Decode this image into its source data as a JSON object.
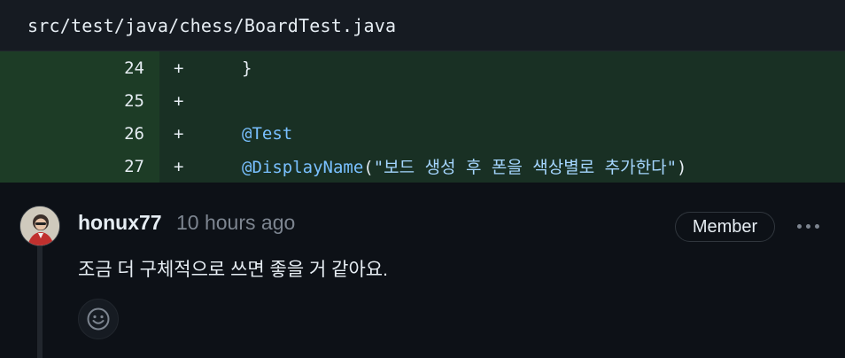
{
  "file": {
    "path": "src/test/java/chess/BoardTest.java"
  },
  "diff": {
    "lines": [
      {
        "number": "24",
        "marker": "+",
        "code": "}"
      },
      {
        "number": "25",
        "marker": "+",
        "code": ""
      },
      {
        "number": "26",
        "marker": "+",
        "code": "@Test"
      },
      {
        "number": "27",
        "marker": "+",
        "code_prefix": "@DisplayName",
        "code_paren_open": "(",
        "code_string": "\"보드 생성 후 폰을 색상별로 추가한다\"",
        "code_paren_close": ")"
      }
    ]
  },
  "comment": {
    "author": "honux77",
    "timestamp": "10 hours ago",
    "role_badge": "Member",
    "body": "조금 더 구체적으로 쓰면 좋을 거 같아요.",
    "avatar_icon": "user-avatar",
    "more_icon": "kebab-horizontal-icon",
    "reaction_icon": "smiley-icon"
  },
  "colors": {
    "page_bg": "#0d1117",
    "added_gutter": "#1d3c26",
    "added_code": "#193024",
    "annotation": "#79c0ff",
    "muted": "#7d8590"
  }
}
